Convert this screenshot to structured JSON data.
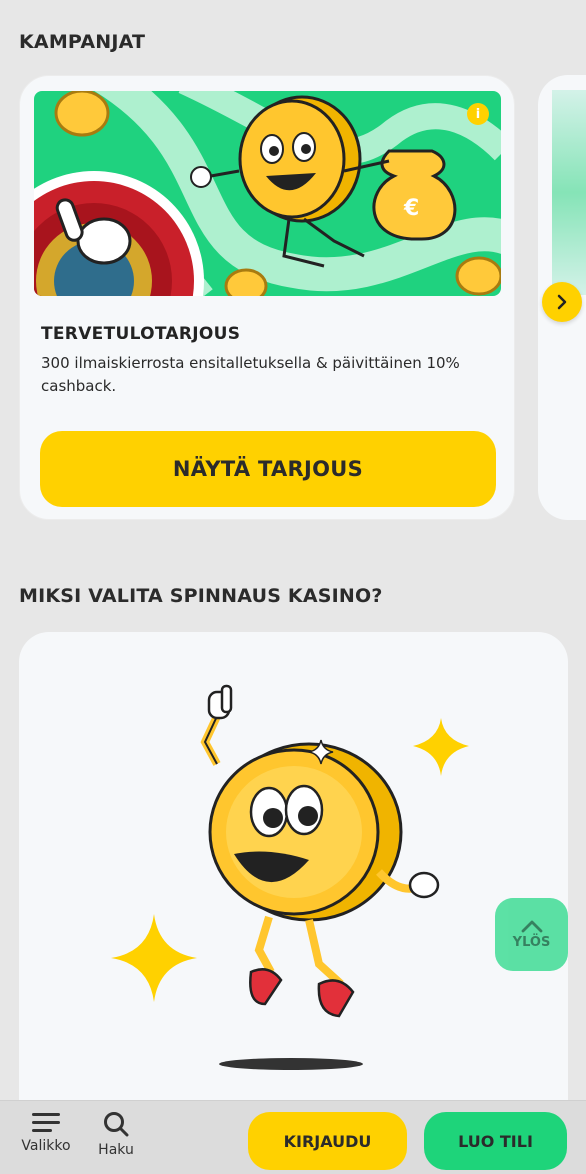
{
  "campaigns": {
    "section_title": "KAMPANJAT",
    "promo": {
      "title": "TERVETULOTARJOUS",
      "description": "300 ilmaiskierrosta ensitalletuksella & päivittäinen 10% cashback.",
      "button_label": "NÄYTÄ TARJOUS",
      "info_icon": "info-icon",
      "info_symbol": "i"
    },
    "next_icon": "chevron-right-icon"
  },
  "why": {
    "section_title": "MIKSI VALITA SPINNAUS KASINO?"
  },
  "scroll_top": {
    "label": "YLÖS",
    "icon": "chevron-up-icon"
  },
  "bottom_bar": {
    "menu_label": "Valikko",
    "menu_icon": "hamburger-icon",
    "search_label": "Haku",
    "search_icon": "search-icon",
    "login_label": "KIRJAUDU",
    "register_label": "LUO TILI"
  },
  "colors": {
    "accent_yellow": "#ffd100",
    "accent_green": "#1ed47a",
    "banner_green": "#1fd27f",
    "background": "#e7e7e7"
  }
}
